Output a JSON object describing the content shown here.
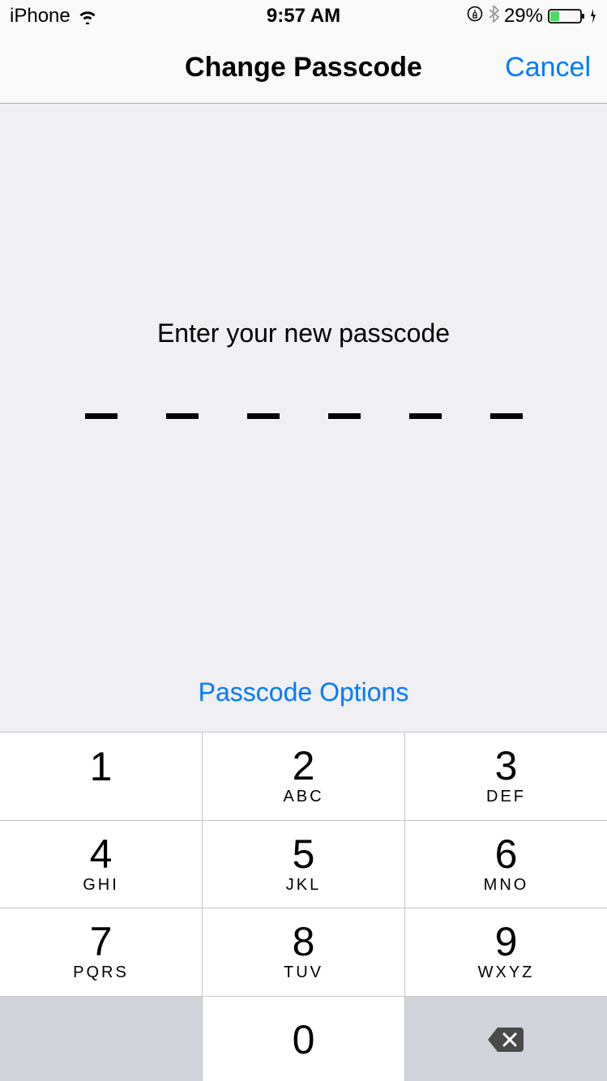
{
  "status_bar": {
    "carrier": "iPhone",
    "time": "9:57 AM",
    "battery_percent": "29%"
  },
  "nav": {
    "title": "Change Passcode",
    "cancel": "Cancel"
  },
  "content": {
    "prompt": "Enter your new passcode",
    "options_link": "Passcode Options",
    "passcode_length": 6
  },
  "keypad": {
    "keys": [
      {
        "digit": "1",
        "letters": ""
      },
      {
        "digit": "2",
        "letters": "ABC"
      },
      {
        "digit": "3",
        "letters": "DEF"
      },
      {
        "digit": "4",
        "letters": "GHI"
      },
      {
        "digit": "5",
        "letters": "JKL"
      },
      {
        "digit": "6",
        "letters": "MNO"
      },
      {
        "digit": "7",
        "letters": "PQRS"
      },
      {
        "digit": "8",
        "letters": "TUV"
      },
      {
        "digit": "9",
        "letters": "WXYZ"
      },
      {
        "digit": "0",
        "letters": ""
      }
    ]
  }
}
